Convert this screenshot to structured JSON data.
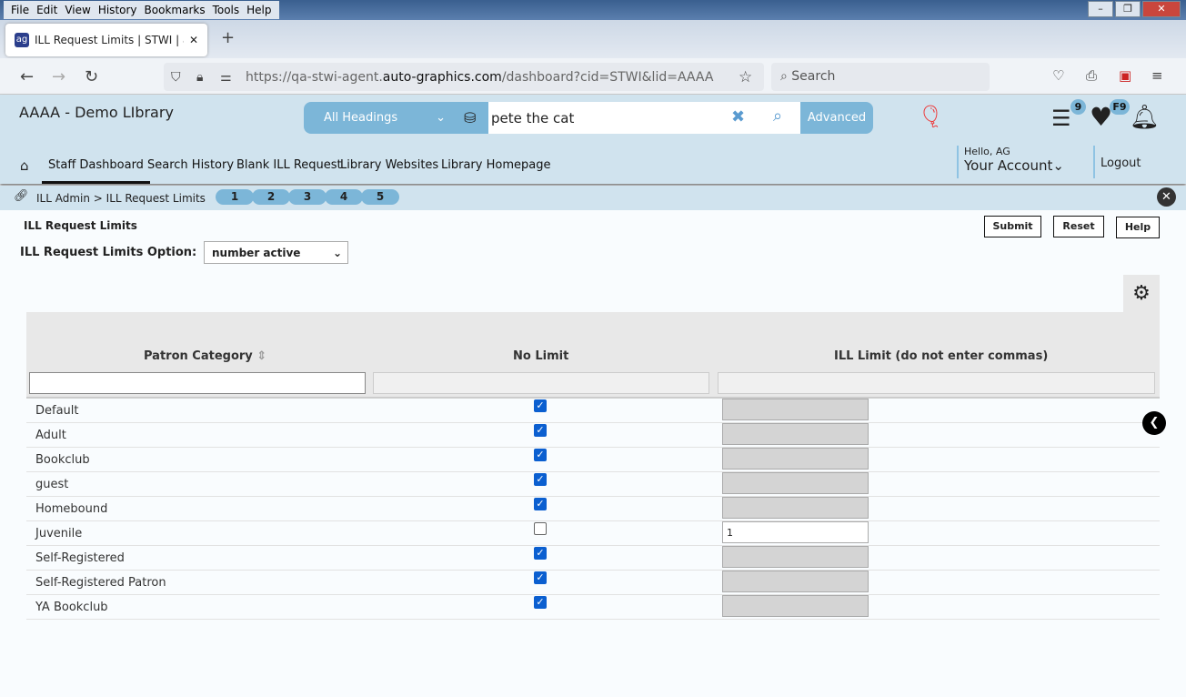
{
  "browser": {
    "menu": [
      "File",
      "Edit",
      "View",
      "History",
      "Bookmarks",
      "Tools",
      "Help"
    ],
    "tab_title": "ILL Request Limits | STWI | aaaa",
    "url_prefix": "https://qa-stwi-agent.",
    "url_domain": "auto-graphics.com",
    "url_suffix": "/dashboard?cid=STWI&lid=AAAA",
    "search_placeholder": "Search"
  },
  "app": {
    "library_name": "AAAA - Demo LIbrary",
    "search_scope": "All Headings",
    "search_value": "pete the cat",
    "advanced_label": "Advanced",
    "list_badge": "9",
    "fav_badge": "F9",
    "nav": [
      "Staff Dashboard",
      "Search History",
      "Blank ILL Request",
      "Library Websites",
      "Library Homepage"
    ],
    "hello": "Hello, AG",
    "account": "Your Account",
    "logout": "Logout"
  },
  "breadcrumb": "ILL Admin > ILL Request Limits",
  "steps": [
    "1",
    "2",
    "3",
    "4",
    "5"
  ],
  "page": {
    "title": "ILL Request Limits",
    "option_label": "ILL Request Limits Option:",
    "option_value": "number active",
    "submit": "Submit",
    "reset": "Reset",
    "help": "Help"
  },
  "table": {
    "headers": [
      "Patron Category",
      "No Limit",
      "ILL Limit (do not enter commas)"
    ],
    "rows": [
      {
        "category": "Default",
        "no_limit": true,
        "limit": ""
      },
      {
        "category": "Adult",
        "no_limit": true,
        "limit": ""
      },
      {
        "category": "Bookclub",
        "no_limit": true,
        "limit": ""
      },
      {
        "category": "guest",
        "no_limit": true,
        "limit": ""
      },
      {
        "category": "Homebound",
        "no_limit": true,
        "limit": ""
      },
      {
        "category": "Juvenile",
        "no_limit": false,
        "limit": "1"
      },
      {
        "category": "Self-Registered",
        "no_limit": true,
        "limit": ""
      },
      {
        "category": "Self-Registered Patron",
        "no_limit": true,
        "limit": ""
      },
      {
        "category": "YA Bookclub",
        "no_limit": true,
        "limit": ""
      }
    ]
  }
}
